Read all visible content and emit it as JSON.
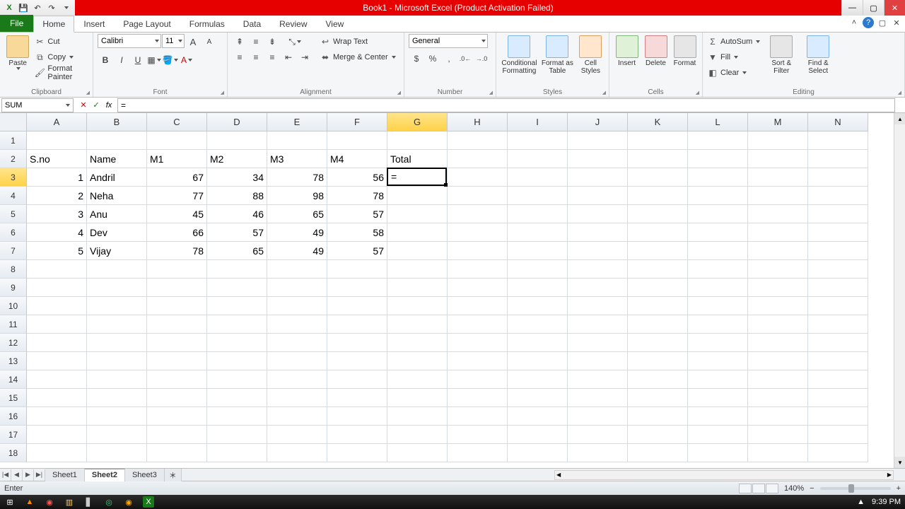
{
  "title": "Book1 - Microsoft Excel (Product Activation Failed)",
  "qat": {
    "save": "💾",
    "undo": "↶",
    "redo": "↷"
  },
  "win": {
    "min": "—",
    "max": "▢",
    "close": "✕"
  },
  "tabs": {
    "file": "File",
    "home": "Home",
    "insert": "Insert",
    "pageLayout": "Page Layout",
    "formulas": "Formulas",
    "data": "Data",
    "review": "Review",
    "view": "View"
  },
  "ribbon_help": {
    "minimize": "˄",
    "help": "?",
    "restore": "▢",
    "closewb": "✕"
  },
  "clipboard": {
    "paste": "Paste",
    "cut": "Cut",
    "copy": "Copy",
    "formatPainter": "Format Painter",
    "group": "Clipboard"
  },
  "font": {
    "name": "Calibri",
    "size": "11",
    "grow": "A",
    "shrink": "A",
    "bold": "B",
    "italic": "I",
    "underline": "U",
    "group": "Font"
  },
  "alignment": {
    "wrap": "Wrap Text",
    "merge": "Merge & Center",
    "group": "Alignment"
  },
  "number": {
    "format": "General",
    "group": "Number",
    "cur": "$",
    "pct": "%",
    "comma": ",",
    "inc": ".0←",
    "dec": "→.0"
  },
  "styles": {
    "cond": "Conditional Formatting",
    "table": "Format as Table",
    "cell": "Cell Styles",
    "group": "Styles"
  },
  "cellsGrp": {
    "insert": "Insert",
    "delete": "Delete",
    "format": "Format",
    "group": "Cells"
  },
  "editing": {
    "sum": "AutoSum",
    "fill": "Fill",
    "clear": "Clear",
    "sort": "Sort & Filter",
    "find": "Find & Select",
    "group": "Editing"
  },
  "formulaBar": {
    "nameBox": "SUM",
    "cancel": "✕",
    "enter": "✓",
    "fx": "fx",
    "formula": "="
  },
  "columns": [
    "A",
    "B",
    "C",
    "D",
    "E",
    "F",
    "G",
    "H",
    "I",
    "J",
    "K",
    "L",
    "M",
    "N"
  ],
  "rows": [
    1,
    2,
    3,
    4,
    5,
    6,
    7,
    8,
    9,
    10,
    11,
    12,
    13,
    14,
    15,
    16,
    17,
    18
  ],
  "activeCol": "G",
  "activeRow": 3,
  "activeCellValue": "=",
  "sheetData": {
    "headers": {
      "row": 2,
      "cells": [
        "S.no",
        "Name",
        "M1",
        "M2",
        "M3",
        "M4",
        "Total"
      ]
    },
    "records": [
      {
        "row": 3,
        "sno": 1,
        "name": "Andril",
        "m1": 67,
        "m2": 34,
        "m3": 78,
        "m4": 56
      },
      {
        "row": 4,
        "sno": 2,
        "name": "Neha",
        "m1": 77,
        "m2": 88,
        "m3": 98,
        "m4": 78
      },
      {
        "row": 5,
        "sno": 3,
        "name": "Anu",
        "m1": 45,
        "m2": 46,
        "m3": 65,
        "m4": 57
      },
      {
        "row": 6,
        "sno": 4,
        "name": "Dev",
        "m1": 66,
        "m2": 57,
        "m3": 49,
        "m4": 58
      },
      {
        "row": 7,
        "sno": 5,
        "name": "Vijay",
        "m1": 78,
        "m2": 65,
        "m3": 49,
        "m4": 57
      }
    ]
  },
  "sheets": {
    "nav": [
      "|◀",
      "◀",
      "▶",
      "▶|"
    ],
    "items": [
      "Sheet1",
      "Sheet2",
      "Sheet3"
    ],
    "active": "Sheet2",
    "new": "＊"
  },
  "status": {
    "mode": "Enter",
    "zoom": "140%",
    "time": "9:39 PM"
  },
  "taskbar": {
    "start": "⊞"
  }
}
